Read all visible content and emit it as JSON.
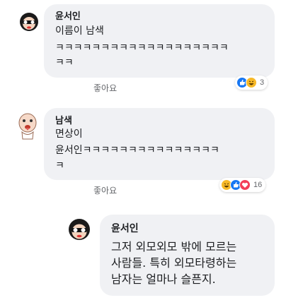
{
  "comments": [
    {
      "author": "윤서인",
      "lines": [
        "이름이 남색",
        "ㅋㅋㅋㅋㅋㅋㅋㅋㅋㅋㅋㅋㅋㅋㅋㅋㅋㅋㅋ",
        "ㅋㅋ"
      ],
      "like_label": "좋아요",
      "reaction_count": "3",
      "reactions": [
        "like-reaction",
        "haha-reaction"
      ]
    },
    {
      "author": "남색",
      "lines": [
        "면상이",
        "윤서인ㅋㅋㅋㅋㅋㅋㅋㅋㅋㅋㅋㅋㅋㅋㅋ",
        "ㅋ"
      ],
      "like_label": "좋아요",
      "reaction_count": "16",
      "reactions": [
        "haha-reaction",
        "like-reaction",
        "love-reaction"
      ]
    },
    {
      "author": "윤서인",
      "lines": [
        "그저 외모외모 밖에 모르는",
        "사람들. 특히 외모타령하는",
        "남자는 얼마나 슬픈지."
      ]
    }
  ],
  "colors": {
    "bubble": "#f0f1f4",
    "like": "#1877f2",
    "haha": "#f7b928",
    "love": "#f33e58"
  }
}
